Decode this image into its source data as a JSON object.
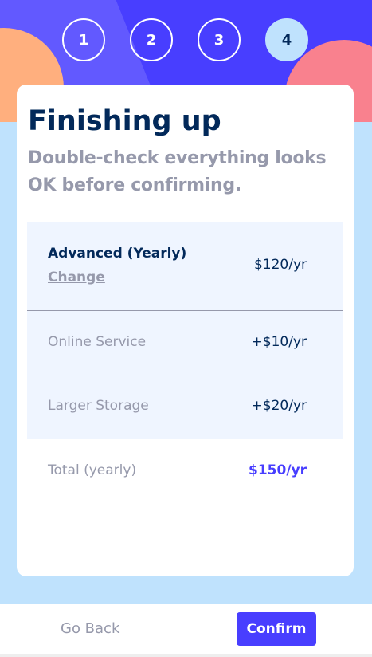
{
  "steps": [
    {
      "number": "1"
    },
    {
      "number": "2"
    },
    {
      "number": "3"
    },
    {
      "number": "4"
    }
  ],
  "header": {
    "title": "Finishing up",
    "subtitle": "Double-check everything looks OK before confirming."
  },
  "summary": {
    "plan_name": "Advanced (Yearly)",
    "change_label": "Change",
    "plan_price": "$120/yr",
    "addons": [
      {
        "name": "Online Service",
        "price": "+$10/yr"
      },
      {
        "name": "Larger Storage",
        "price": "+$20/yr"
      }
    ],
    "total_label": "Total (yearly)",
    "total_price": "$150/yr"
  },
  "footer": {
    "back_label": "Go Back",
    "confirm_label": "Confirm"
  },
  "colors": {
    "accent": "#483eff",
    "header_bg": "#483eff",
    "page_bg": "#bfe2fd",
    "title": "#02295a",
    "muted": "#9699ab",
    "summary_bg": "#eff5ff"
  }
}
